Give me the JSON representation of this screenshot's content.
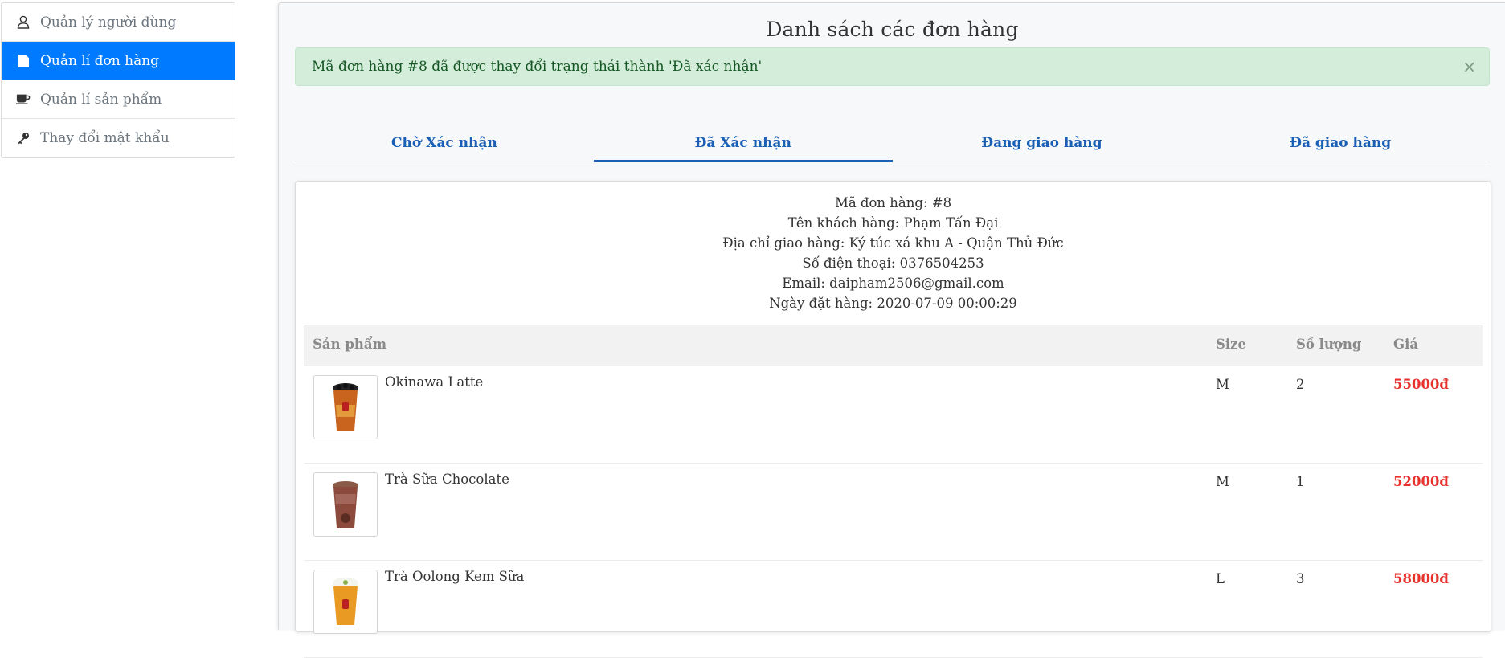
{
  "sidebar": {
    "items": [
      {
        "label": "Quản lý người dùng",
        "icon": "user-icon"
      },
      {
        "label": "Quản lí đơn hàng",
        "icon": "document-icon"
      },
      {
        "label": "Quản lí sản phẩm",
        "icon": "coffee-cup-icon"
      },
      {
        "label": "Thay đổi mật khẩu",
        "icon": "key-icon"
      }
    ]
  },
  "main": {
    "title": "Danh sách các đơn hàng",
    "alert": {
      "message": "Mã đơn hàng #8 đã được thay đổi trạng thái thành 'Đã xác nhận'",
      "close": "×"
    },
    "tabs": [
      {
        "label": "Chờ Xác nhận"
      },
      {
        "label": "Đã Xác nhận"
      },
      {
        "label": "Đang giao hàng"
      },
      {
        "label": "Đã giao hàng"
      }
    ],
    "order": {
      "id": "Mã đơn hàng: #8",
      "customer": "Tên khách hàng: Phạm Tấn Đại",
      "address": "Địa chỉ giao hàng: Ký túc xá khu A - Quận Thủ Đức",
      "phone": "Số điện thoại: 0376504253",
      "email": "Email: daipham2506@gmail.com",
      "date": "Ngày đặt hàng: 2020-07-09 00:00:29",
      "headers": {
        "product": "Sản phẩm",
        "size": "Size",
        "qty": "Số lượng",
        "price": "Giá"
      },
      "items": [
        {
          "name": "Okinawa Latte",
          "size": "M",
          "qty": "2",
          "price": "55000đ"
        },
        {
          "name": "Trà Sữa Chocolate",
          "size": "M",
          "qty": "1",
          "price": "52000đ"
        },
        {
          "name": "Trà Oolong Kem Sữa",
          "size": "L",
          "qty": "3",
          "price": "58000đ"
        }
      ]
    }
  },
  "colors": {
    "accent": "#007bff",
    "tab": "#1a5fb4",
    "price": "#e8322d",
    "alert_bg": "#d4edda"
  }
}
